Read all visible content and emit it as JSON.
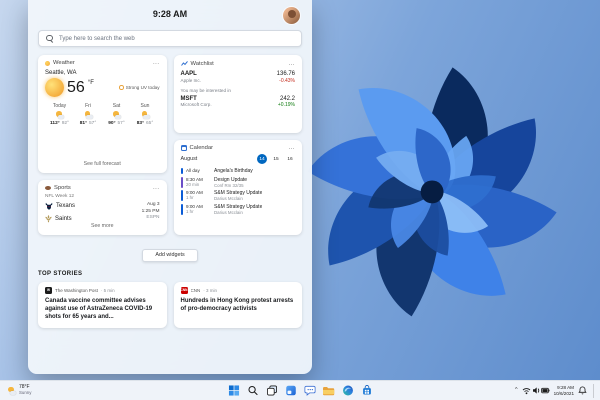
{
  "panel": {
    "time": "9:28 AM",
    "search": {
      "placeholder": "Type here to search the web"
    },
    "add_widgets": "Add widgets"
  },
  "icons": {
    "more": "...",
    "chevron_up": "^"
  },
  "widgets": {
    "weather": {
      "title": "Weather",
      "location": "Seattle, WA",
      "temperature": "56",
      "unit": "°F",
      "alert": "Strong UV today",
      "forecast": [
        {
          "day": "Today",
          "high": "112°",
          "low": "92°"
        },
        {
          "day": "Fri",
          "high": "81°",
          "low": "57°"
        },
        {
          "day": "Sat",
          "high": "90°",
          "low": "57°"
        },
        {
          "day": "Sun",
          "high": "83°",
          "low": "65°"
        }
      ],
      "footer": "See full forecast"
    },
    "watchlist": {
      "title": "Watchlist",
      "suggestion_label": "You may be interested in",
      "stocks": [
        {
          "symbol": "AAPL",
          "company": "Apple Inc.",
          "price": "136.76",
          "change": "-0.43%",
          "change_color": "#c42b1c"
        },
        {
          "symbol": "MSFT",
          "company": "Microsoft Corp.",
          "price": "242.2",
          "change": "+0.19%",
          "change_color": "#0f7b0f"
        }
      ]
    },
    "calendar": {
      "title": "Calendar",
      "month": "August",
      "dates": [
        "14",
        "15",
        "16"
      ],
      "selected_date": "14",
      "events": [
        {
          "time": "All day",
          "duration": "",
          "title": "Angela's Birthday",
          "subtitle": "",
          "color": "#0b5cd6"
        },
        {
          "time": "8:30 AM",
          "duration": "20 min",
          "title": "Design Update",
          "subtitle": "Conf Rm 32/35",
          "color": "#6b4fc8"
        },
        {
          "time": "9:00 AM",
          "duration": "1 hr",
          "title": "S&M Strategy Update",
          "subtitle": "Darius Mcclain",
          "color": "#0b5cd6"
        },
        {
          "time": "9:00 AM",
          "duration": "1 hr",
          "title": "S&M Strategy Update",
          "subtitle": "Darius Mcclain",
          "color": "#0b5cd6"
        }
      ]
    },
    "sports": {
      "title": "Sports",
      "league_week": "NFL Week 12",
      "teams": [
        {
          "name": "Texans"
        },
        {
          "name": "Saints"
        }
      ],
      "date": "Aug 3",
      "game_time": "1:25 PM",
      "channel": "ESPN",
      "footer": "See more"
    }
  },
  "top_stories": {
    "heading": "TOP STORIES",
    "stories": [
      {
        "source": "The Washington Post",
        "read_time": "5 min",
        "favicon": "W",
        "favicon_bg": "#1b1b1b",
        "headline": "Canada vaccine committee advises against use of AstraZeneca COVID-19 shots for 65 years and..."
      },
      {
        "source": "CNN",
        "read_time": "3 min",
        "favicon": "CNN",
        "favicon_bg": "#cc0000",
        "headline": "Hundreds in Hong Kong protest arrests of pro-democracy activists"
      }
    ]
  },
  "taskbar": {
    "weather": {
      "temp": "78°F",
      "condition": "Sunny"
    },
    "clock": {
      "time": "9:28 AM",
      "date": "10/6/2021"
    }
  },
  "colors": {
    "accent": "#0067c0",
    "stock_down": "#c42b1c",
    "stock_up": "#0f7b0f"
  }
}
